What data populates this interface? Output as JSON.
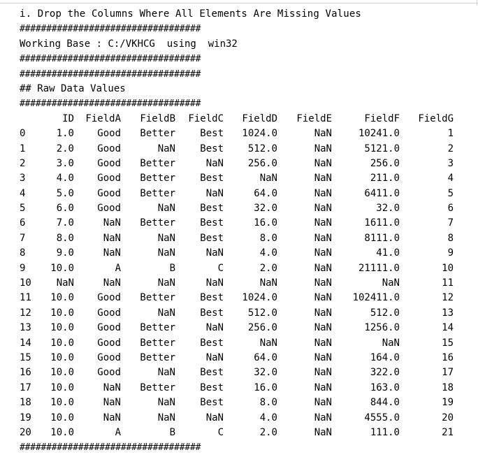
{
  "output": {
    "title": "i. Drop the Columns Where All Elements Are Missing Values",
    "separator": "##################################",
    "working_base": "Working Base : C:/VKHCG  using  win32",
    "section_header": "## Raw Data Values",
    "table": {
      "columns": [
        "ID",
        "FieldA",
        "FieldB",
        "FieldC",
        "FieldD",
        "FieldE",
        "FieldF",
        "FieldG"
      ],
      "rows": [
        [
          "0",
          "1.0",
          "Good",
          "Better",
          "Best",
          "1024.0",
          "NaN",
          "10241.0",
          "1"
        ],
        [
          "1",
          "2.0",
          "Good",
          "NaN",
          "Best",
          "512.0",
          "NaN",
          "5121.0",
          "2"
        ],
        [
          "2",
          "3.0",
          "Good",
          "Better",
          "NaN",
          "256.0",
          "NaN",
          "256.0",
          "3"
        ],
        [
          "3",
          "4.0",
          "Good",
          "Better",
          "Best",
          "NaN",
          "NaN",
          "211.0",
          "4"
        ],
        [
          "4",
          "5.0",
          "Good",
          "Better",
          "NaN",
          "64.0",
          "NaN",
          "6411.0",
          "5"
        ],
        [
          "5",
          "6.0",
          "Good",
          "NaN",
          "Best",
          "32.0",
          "NaN",
          "32.0",
          "6"
        ],
        [
          "6",
          "7.0",
          "NaN",
          "Better",
          "Best",
          "16.0",
          "NaN",
          "1611.0",
          "7"
        ],
        [
          "7",
          "8.0",
          "NaN",
          "NaN",
          "Best",
          "8.0",
          "NaN",
          "8111.0",
          "8"
        ],
        [
          "8",
          "9.0",
          "NaN",
          "NaN",
          "NaN",
          "4.0",
          "NaN",
          "41.0",
          "9"
        ],
        [
          "9",
          "10.0",
          "A",
          "B",
          "C",
          "2.0",
          "NaN",
          "21111.0",
          "10"
        ],
        [
          "10",
          "NaN",
          "NaN",
          "NaN",
          "NaN",
          "NaN",
          "NaN",
          "NaN",
          "11"
        ],
        [
          "11",
          "10.0",
          "Good",
          "Better",
          "Best",
          "1024.0",
          "NaN",
          "102411.0",
          "12"
        ],
        [
          "12",
          "10.0",
          "Good",
          "NaN",
          "Best",
          "512.0",
          "NaN",
          "512.0",
          "13"
        ],
        [
          "13",
          "10.0",
          "Good",
          "Better",
          "NaN",
          "256.0",
          "NaN",
          "1256.0",
          "14"
        ],
        [
          "14",
          "10.0",
          "Good",
          "Better",
          "Best",
          "NaN",
          "NaN",
          "NaN",
          "15"
        ],
        [
          "15",
          "10.0",
          "Good",
          "Better",
          "NaN",
          "64.0",
          "NaN",
          "164.0",
          "16"
        ],
        [
          "16",
          "10.0",
          "Good",
          "NaN",
          "Best",
          "32.0",
          "NaN",
          "322.0",
          "17"
        ],
        [
          "17",
          "10.0",
          "NaN",
          "Better",
          "Best",
          "16.0",
          "NaN",
          "163.0",
          "18"
        ],
        [
          "18",
          "10.0",
          "NaN",
          "NaN",
          "Best",
          "8.0",
          "NaN",
          "844.0",
          "19"
        ],
        [
          "19",
          "10.0",
          "NaN",
          "NaN",
          "NaN",
          "4.0",
          "NaN",
          "4555.0",
          "20"
        ],
        [
          "20",
          "10.0",
          "A",
          "B",
          "C",
          "2.0",
          "NaN",
          "111.0",
          "21"
        ]
      ]
    }
  }
}
